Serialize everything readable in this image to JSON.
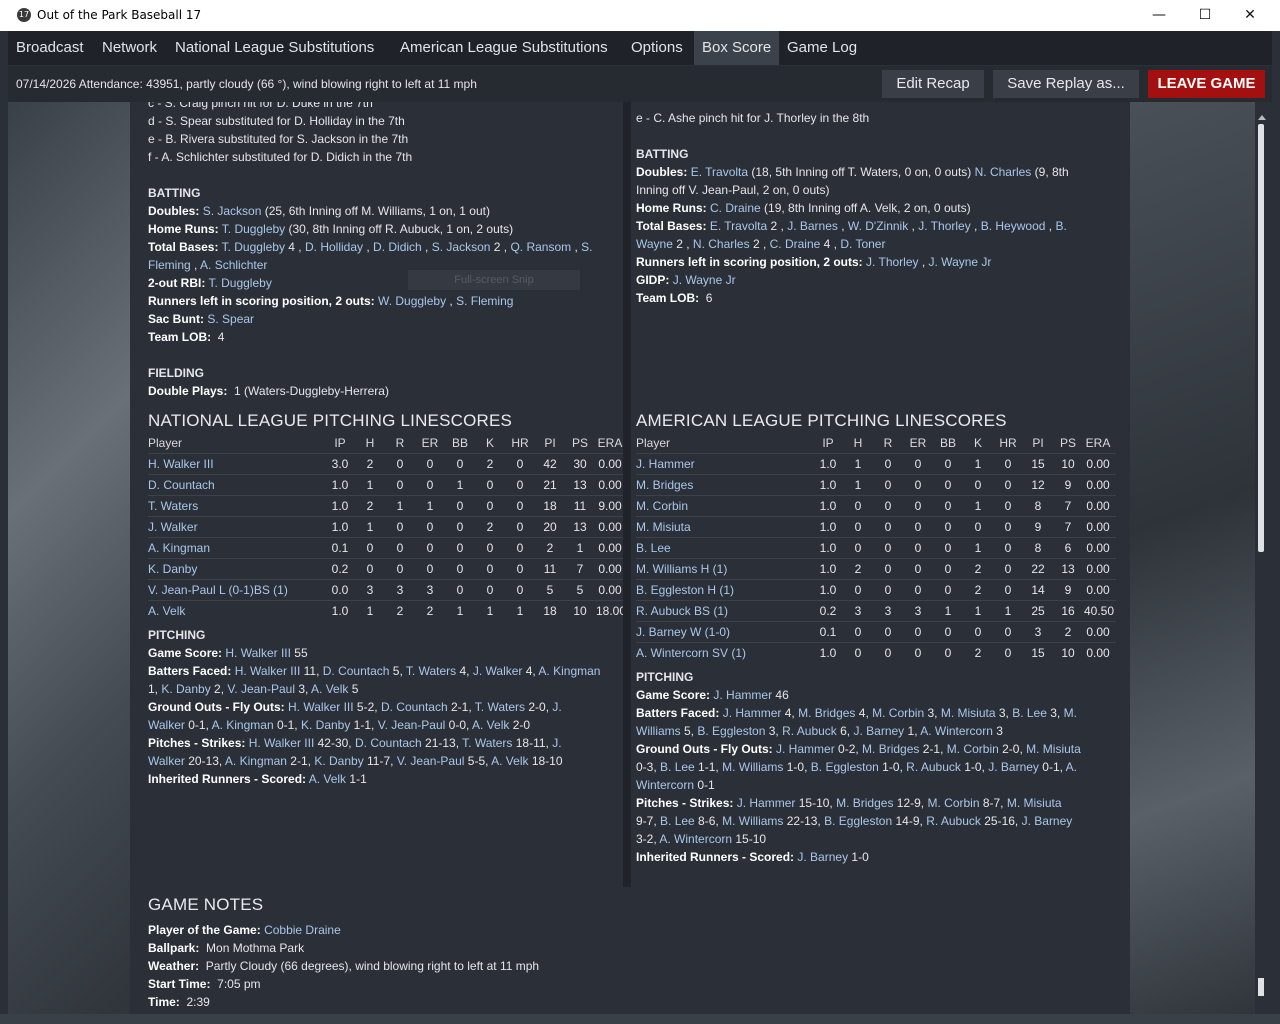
{
  "window": {
    "title": "Out of the Park Baseball 17",
    "icon": "17"
  },
  "menu": [
    {
      "label": "Broadcast"
    },
    {
      "label": "Network"
    },
    {
      "label": "National League Substitutions"
    },
    {
      "label": "American League Substitutions"
    },
    {
      "label": "Options"
    },
    {
      "label": "Box Score"
    },
    {
      "label": "Game Log"
    }
  ],
  "info": {
    "text": "07/14/2026 Attendance: 43951, partly cloudy (66 °), wind blowing right to left at 11 mph",
    "edit_recap": "Edit Recap",
    "save_replay": "Save Replay as...",
    "leave_game": "LEAVE GAME"
  },
  "snip_label": "Full-screen Snip",
  "nl": {
    "subs": [
      "c - S. Craig pinch hit for D. Duke in the 7th",
      "d - S. Spear substituted for D. Holliday in the 7th",
      "e - B. Rivera substituted for S. Jackson in the 7th",
      "f - A. Schlichter substituted for D. Didich in the 7th"
    ],
    "batting_h": "BATTING",
    "fielding_h": "FIELDING",
    "double_plays_label": "Double Plays:",
    "double_plays": "1 (Waters-Duggleby-Herrera)",
    "pitching_title": "NATIONAL LEAGUE PITCHING LINESCORES",
    "pitching_h": "PITCHING"
  },
  "al": {
    "sub_partial": "e - C. Ashe pinch hit for J. Thorley in the 8th",
    "batting_h": "BATTING",
    "pitching_title": "AMERICAN LEAGUE PITCHING LINESCORES",
    "pitching_h": "PITCHING"
  },
  "pitch_headers": [
    "Player",
    "IP",
    "H",
    "R",
    "ER",
    "BB",
    "K",
    "HR",
    "PI",
    "PS",
    "ERA"
  ],
  "nl_pitchers": [
    [
      "H. Walker III",
      "3.0",
      "2",
      "0",
      "0",
      "0",
      "2",
      "0",
      "42",
      "30",
      "0.00"
    ],
    [
      "D. Countach",
      "1.0",
      "1",
      "0",
      "0",
      "1",
      "0",
      "0",
      "21",
      "13",
      "0.00"
    ],
    [
      "T. Waters",
      "1.0",
      "2",
      "1",
      "1",
      "0",
      "0",
      "0",
      "18",
      "11",
      "9.00"
    ],
    [
      "J. Walker",
      "1.0",
      "1",
      "0",
      "0",
      "0",
      "2",
      "0",
      "20",
      "13",
      "0.00"
    ],
    [
      "A. Kingman",
      "0.1",
      "0",
      "0",
      "0",
      "0",
      "0",
      "0",
      "2",
      "1",
      "0.00"
    ],
    [
      "K. Danby",
      "0.2",
      "0",
      "0",
      "0",
      "0",
      "0",
      "0",
      "11",
      "7",
      "0.00"
    ],
    [
      "V. Jean-Paul L (0-1)BS (1)",
      "0.0",
      "3",
      "3",
      "3",
      "0",
      "0",
      "0",
      "5",
      "5",
      "0.00"
    ],
    [
      "A. Velk",
      "1.0",
      "1",
      "2",
      "2",
      "1",
      "1",
      "1",
      "18",
      "10",
      "18.00"
    ]
  ],
  "al_pitchers": [
    [
      "J. Hammer",
      "1.0",
      "1",
      "0",
      "0",
      "0",
      "1",
      "0",
      "15",
      "10",
      "0.00"
    ],
    [
      "M. Bridges",
      "1.0",
      "1",
      "0",
      "0",
      "0",
      "0",
      "0",
      "12",
      "9",
      "0.00"
    ],
    [
      "M. Corbin",
      "1.0",
      "0",
      "0",
      "0",
      "0",
      "1",
      "0",
      "8",
      "7",
      "0.00"
    ],
    [
      "M. Misiuta",
      "1.0",
      "0",
      "0",
      "0",
      "0",
      "0",
      "0",
      "9",
      "7",
      "0.00"
    ],
    [
      "B. Lee",
      "1.0",
      "0",
      "0",
      "0",
      "0",
      "1",
      "0",
      "8",
      "6",
      "0.00"
    ],
    [
      "M. Williams H (1)",
      "1.0",
      "2",
      "0",
      "0",
      "0",
      "2",
      "0",
      "22",
      "13",
      "0.00"
    ],
    [
      "B. Eggleston H (1)",
      "1.0",
      "0",
      "0",
      "0",
      "0",
      "2",
      "0",
      "14",
      "9",
      "0.00"
    ],
    [
      "R. Aubuck BS (1)",
      "0.2",
      "3",
      "3",
      "3",
      "1",
      "1",
      "1",
      "25",
      "16",
      "40.50"
    ],
    [
      "J. Barney W (1-0)",
      "0.1",
      "0",
      "0",
      "0",
      "0",
      "0",
      "0",
      "3",
      "2",
      "0.00"
    ],
    [
      "A. Wintercorn SV (1)",
      "1.0",
      "0",
      "0",
      "0",
      "0",
      "2",
      "0",
      "15",
      "10",
      "0.00"
    ]
  ],
  "notes": {
    "title": "GAME NOTES",
    "potg_label": "Player of the Game:",
    "potg": "Cobbie Draine",
    "ballpark_label": "Ballpark:",
    "ballpark": "Mon Mothma Park",
    "weather_label": "Weather:",
    "weather": "Partly Cloudy (66 degrees), wind blowing right to left at 11 mph",
    "start_label": "Start Time:",
    "start": "7:05 pm",
    "time_label": "Time:",
    "time": "2:39"
  }
}
